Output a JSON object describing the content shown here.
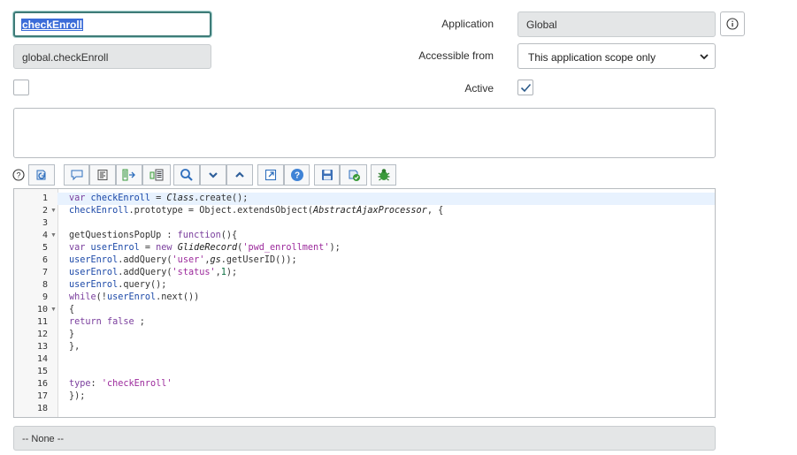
{
  "form": {
    "name_value": "checkEnroll",
    "api_name_value": "global.checkEnroll",
    "application_label": "Application",
    "application_value": "Global",
    "accessible_label": "Accessible from",
    "accessible_value": "This application scope only",
    "active_label": "Active",
    "active_checked": true,
    "client_callable_checked": false,
    "description_value": ""
  },
  "toolbar": {
    "buttons": [
      {
        "name": "toggle-syntax-editor-button",
        "icon": "syntax-toggle-icon"
      },
      {
        "name": "comment-selected-button",
        "icon": "comment-icon"
      },
      {
        "name": "format-code-button",
        "icon": "format-icon"
      },
      {
        "name": "insert-macro-button",
        "icon": "insert-macro-icon"
      },
      {
        "name": "script-include-button",
        "icon": "script-include-icon"
      },
      {
        "name": "search-button",
        "icon": "search-icon"
      },
      {
        "name": "find-next-button",
        "icon": "chevron-down-icon"
      },
      {
        "name": "find-previous-button",
        "icon": "chevron-up-icon"
      },
      {
        "name": "fullscreen-button",
        "icon": "expand-icon"
      },
      {
        "name": "help-button",
        "icon": "question-icon"
      },
      {
        "name": "save-button",
        "icon": "save-icon"
      },
      {
        "name": "script-debugger-button",
        "icon": "debugger-icon"
      },
      {
        "name": "debug-button",
        "icon": "bug-icon"
      }
    ]
  },
  "editor": {
    "line_numbers": [
      "1",
      "2",
      "3",
      "4",
      "5",
      "6",
      "7",
      "8",
      "9",
      "10",
      "11",
      "12",
      "13",
      "14",
      "15",
      "16",
      "17",
      "18"
    ],
    "lines": [
      "var checkEnroll = Class.create();",
      "checkEnroll.prototype = Object.extendsObject(AbstractAjaxProcessor, {",
      "",
      "getQuestionsPopUp : function(){",
      "var userEnrol = new GlideRecord('pwd_enrollment');",
      "userEnrol.addQuery('user',gs.getUserID());",
      "userEnrol.addQuery('status',1);",
      "userEnrol.query();",
      "while(!userEnrol.next())",
      "{",
      "return false ;",
      "}",
      "},",
      "",
      "",
      "type: 'checkEnroll'",
      "});",
      ""
    ]
  },
  "bottom_field": {
    "value": "-- None --"
  },
  "colors": {
    "accent_focus": "#3e7b78",
    "selection": "#3b6cd8",
    "readonly_bg": "#e4e6e7",
    "toolbar_icon_blue": "#2f6fbd",
    "toolbar_icon_green": "#3a9a3a"
  }
}
